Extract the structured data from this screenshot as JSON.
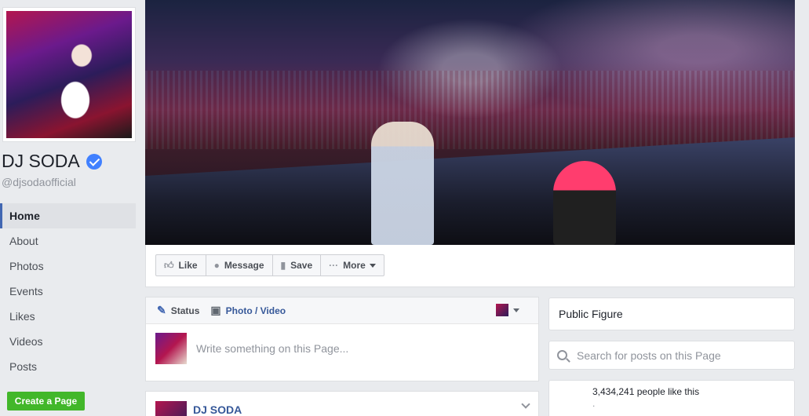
{
  "profile": {
    "name": "DJ SODA",
    "handle": "@djsodaofficial"
  },
  "sidebar": {
    "items": [
      {
        "label": "Home"
      },
      {
        "label": "About"
      },
      {
        "label": "Photos"
      },
      {
        "label": "Events"
      },
      {
        "label": "Likes"
      },
      {
        "label": "Videos"
      },
      {
        "label": "Posts"
      }
    ],
    "create_page_label": "Create a Page"
  },
  "actions": {
    "like": "Like",
    "message": "Message",
    "save": "Save",
    "more": "More"
  },
  "composer": {
    "status_tab": "Status",
    "photo_tab": "Photo / Video",
    "placeholder": "Write something on this Page..."
  },
  "post": {
    "author": "DJ SODA"
  },
  "right": {
    "category": "Public Figure",
    "search_placeholder": "Search for posts on this Page",
    "likes_text": "3,434,241 people like this",
    "likes_sub": "."
  },
  "colors": {
    "brand_blue": "#4267b2",
    "link_blue": "#365899",
    "green": "#42b72a",
    "verified": "#4080ff",
    "background": "#e9ebee"
  }
}
